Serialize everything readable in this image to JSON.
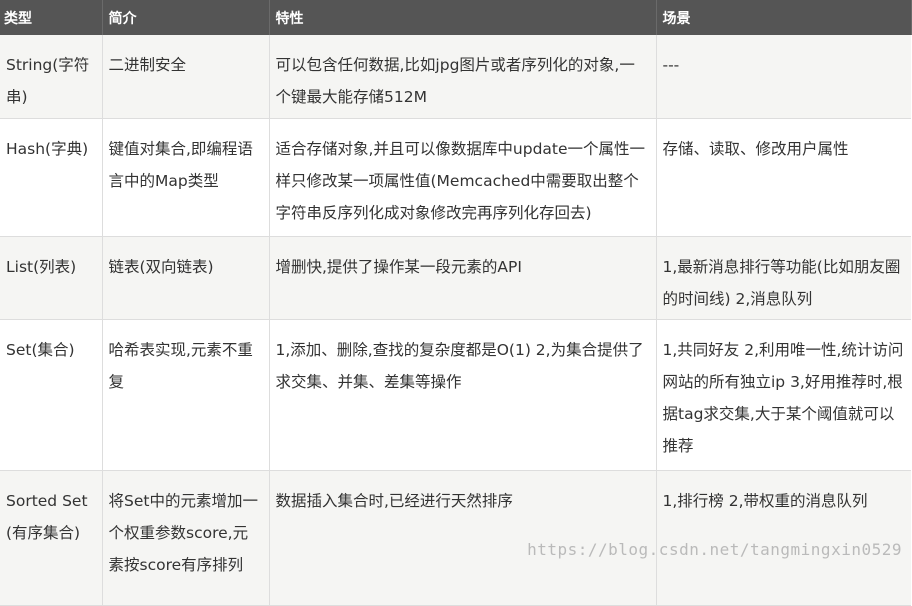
{
  "table": {
    "headers": [
      "类型",
      "简介",
      "特性",
      "场景"
    ],
    "rows": [
      [
        "String(字符串)",
        "二进制安全",
        "可以包含任何数据,比如jpg图片或者序列化的对象,一个键最大能存储512M",
        "---"
      ],
      [
        "Hash(字典)",
        "键值对集合,即编程语言中的Map类型",
        "适合存储对象,并且可以像数据库中update一个属性一样只修改某一项属性值(Memcached中需要取出整个字符串反序列化成对象修改完再序列化存回去)",
        "存储、读取、修改用户属性"
      ],
      [
        "List(列表)",
        "链表(双向链表)",
        "增删快,提供了操作某一段元素的API",
        "1,最新消息排行等功能(比如朋友圈的时间线) 2,消息队列"
      ],
      [
        "Set(集合)",
        "哈希表实现,元素不重复",
        "1,添加、删除,查找的复杂度都是O(1) 2,为集合提供了求交集、并集、差集等操作",
        "1,共同好友 2,利用唯一性,统计访问网站的所有独立ip 3,好用推荐时,根据tag求交集,大于某个阈值就可以推荐"
      ],
      [
        "Sorted Set(有序集合)",
        "将Set中的元素增加一个权重参数score,元素按score有序排列",
        "数据插入集合时,已经进行天然排序",
        "1,排行榜 2,带权重的消息队列"
      ]
    ]
  },
  "watermark": "https://blog.csdn.net/tangmingxin0529"
}
